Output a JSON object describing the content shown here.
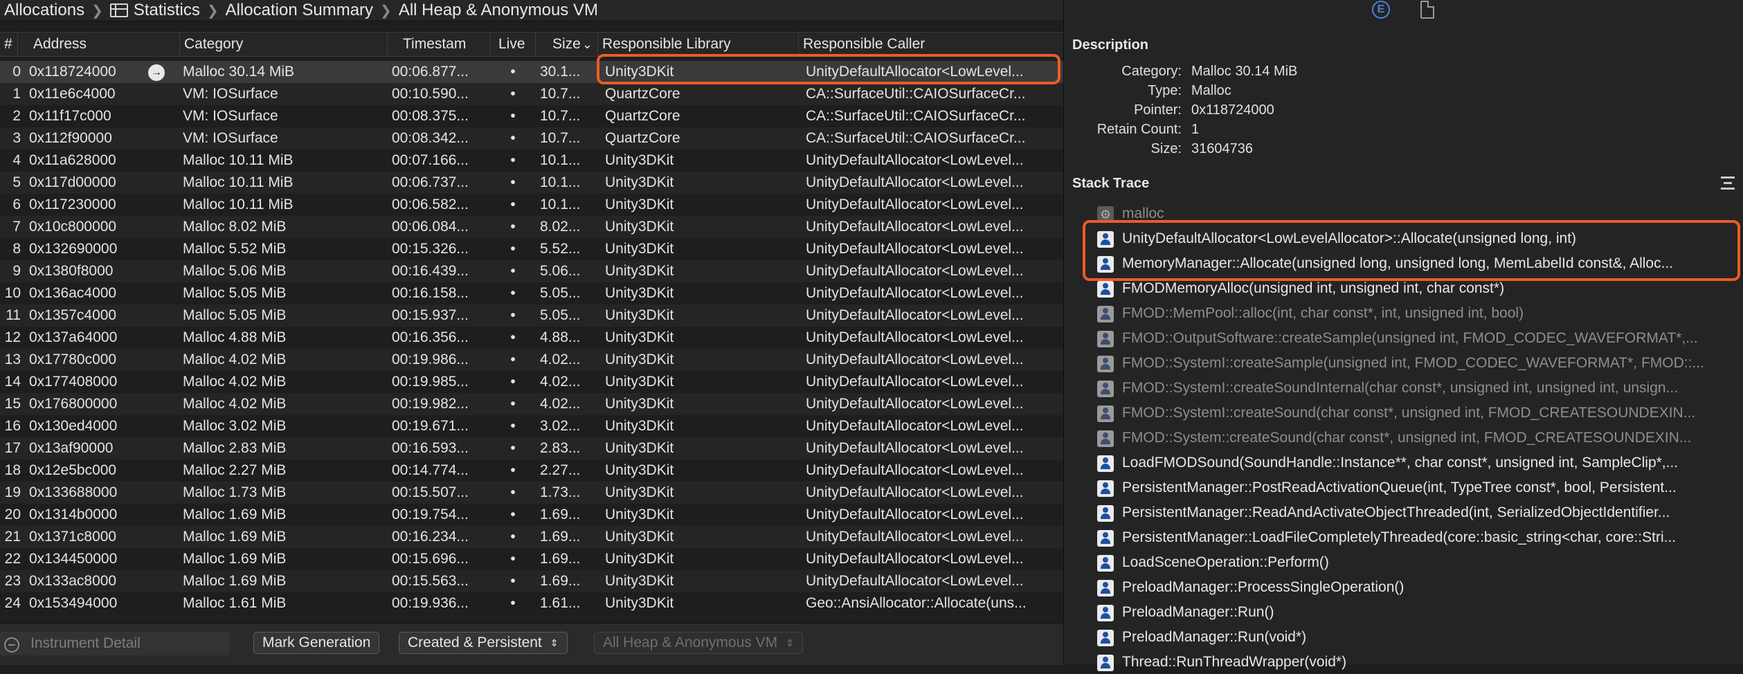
{
  "breadcrumb": {
    "items": [
      "Allocations",
      "Statistics",
      "Allocation Summary",
      "All Heap & Anonymous VM"
    ]
  },
  "table": {
    "headers": {
      "num": "#",
      "address": "Address",
      "category": "Category",
      "timestamp": "Timestam",
      "live": "Live",
      "size": "Size",
      "sort_indicator": "⌄",
      "library": "Responsible Library",
      "caller": "Responsible Caller"
    },
    "rows": [
      {
        "num": "0",
        "address": "0x118724000",
        "category": "Malloc 30.14 MiB",
        "timestamp": "00:06.877...",
        "live": "•",
        "size": "30.1...",
        "library": "Unity3DKit",
        "caller": "UnityDefaultAllocator<LowLevel..."
      },
      {
        "num": "1",
        "address": "0x11e6c4000",
        "category": "VM: IOSurface",
        "timestamp": "00:10.590...",
        "live": "•",
        "size": "10.7...",
        "library": "QuartzCore",
        "caller": "CA::SurfaceUtil::CAIOSurfaceCr..."
      },
      {
        "num": "2",
        "address": "0x11f17c000",
        "category": "VM: IOSurface",
        "timestamp": "00:08.375...",
        "live": "•",
        "size": "10.7...",
        "library": "QuartzCore",
        "caller": "CA::SurfaceUtil::CAIOSurfaceCr..."
      },
      {
        "num": "3",
        "address": "0x112f90000",
        "category": "VM: IOSurface",
        "timestamp": "00:08.342...",
        "live": "•",
        "size": "10.7...",
        "library": "QuartzCore",
        "caller": "CA::SurfaceUtil::CAIOSurfaceCr..."
      },
      {
        "num": "4",
        "address": "0x11a628000",
        "category": "Malloc 10.11 MiB",
        "timestamp": "00:07.166...",
        "live": "•",
        "size": "10.1...",
        "library": "Unity3DKit",
        "caller": "UnityDefaultAllocator<LowLevel..."
      },
      {
        "num": "5",
        "address": "0x117d00000",
        "category": "Malloc 10.11 MiB",
        "timestamp": "00:06.737...",
        "live": "•",
        "size": "10.1...",
        "library": "Unity3DKit",
        "caller": "UnityDefaultAllocator<LowLevel..."
      },
      {
        "num": "6",
        "address": "0x117230000",
        "category": "Malloc 10.11 MiB",
        "timestamp": "00:06.582...",
        "live": "•",
        "size": "10.1...",
        "library": "Unity3DKit",
        "caller": "UnityDefaultAllocator<LowLevel..."
      },
      {
        "num": "7",
        "address": "0x10c800000",
        "category": "Malloc 8.02 MiB",
        "timestamp": "00:06.084...",
        "live": "•",
        "size": "8.02...",
        "library": "Unity3DKit",
        "caller": "UnityDefaultAllocator<LowLevel..."
      },
      {
        "num": "8",
        "address": "0x132690000",
        "category": "Malloc 5.52 MiB",
        "timestamp": "00:15.326...",
        "live": "•",
        "size": "5.52...",
        "library": "Unity3DKit",
        "caller": "UnityDefaultAllocator<LowLevel..."
      },
      {
        "num": "9",
        "address": "0x1380f8000",
        "category": "Malloc 5.06 MiB",
        "timestamp": "00:16.439...",
        "live": "•",
        "size": "5.06...",
        "library": "Unity3DKit",
        "caller": "UnityDefaultAllocator<LowLevel..."
      },
      {
        "num": "10",
        "address": "0x136ac4000",
        "category": "Malloc 5.05 MiB",
        "timestamp": "00:16.158...",
        "live": "•",
        "size": "5.05...",
        "library": "Unity3DKit",
        "caller": "UnityDefaultAllocator<LowLevel..."
      },
      {
        "num": "11",
        "address": "0x1357c4000",
        "category": "Malloc 5.05 MiB",
        "timestamp": "00:15.937...",
        "live": "•",
        "size": "5.05...",
        "library": "Unity3DKit",
        "caller": "UnityDefaultAllocator<LowLevel..."
      },
      {
        "num": "12",
        "address": "0x137a64000",
        "category": "Malloc 4.88 MiB",
        "timestamp": "00:16.356...",
        "live": "•",
        "size": "4.88...",
        "library": "Unity3DKit",
        "caller": "UnityDefaultAllocator<LowLevel..."
      },
      {
        "num": "13",
        "address": "0x17780c000",
        "category": "Malloc 4.02 MiB",
        "timestamp": "00:19.986...",
        "live": "•",
        "size": "4.02...",
        "library": "Unity3DKit",
        "caller": "UnityDefaultAllocator<LowLevel..."
      },
      {
        "num": "14",
        "address": "0x177408000",
        "category": "Malloc 4.02 MiB",
        "timestamp": "00:19.985...",
        "live": "•",
        "size": "4.02...",
        "library": "Unity3DKit",
        "caller": "UnityDefaultAllocator<LowLevel..."
      },
      {
        "num": "15",
        "address": "0x176800000",
        "category": "Malloc 4.02 MiB",
        "timestamp": "00:19.982...",
        "live": "•",
        "size": "4.02...",
        "library": "Unity3DKit",
        "caller": "UnityDefaultAllocator<LowLevel..."
      },
      {
        "num": "16",
        "address": "0x130ed4000",
        "category": "Malloc 3.02 MiB",
        "timestamp": "00:19.671...",
        "live": "•",
        "size": "3.02...",
        "library": "Unity3DKit",
        "caller": "UnityDefaultAllocator<LowLevel..."
      },
      {
        "num": "17",
        "address": "0x13af90000",
        "category": "Malloc 2.83 MiB",
        "timestamp": "00:16.593...",
        "live": "•",
        "size": "2.83...",
        "library": "Unity3DKit",
        "caller": "UnityDefaultAllocator<LowLevel..."
      },
      {
        "num": "18",
        "address": "0x12e5bc000",
        "category": "Malloc 2.27 MiB",
        "timestamp": "00:14.774...",
        "live": "•",
        "size": "2.27...",
        "library": "Unity3DKit",
        "caller": "UnityDefaultAllocator<LowLevel..."
      },
      {
        "num": "19",
        "address": "0x133688000",
        "category": "Malloc 1.73 MiB",
        "timestamp": "00:15.507...",
        "live": "•",
        "size": "1.73...",
        "library": "Unity3DKit",
        "caller": "UnityDefaultAllocator<LowLevel..."
      },
      {
        "num": "20",
        "address": "0x1314b0000",
        "category": "Malloc 1.69 MiB",
        "timestamp": "00:19.754...",
        "live": "•",
        "size": "1.69...",
        "library": "Unity3DKit",
        "caller": "UnityDefaultAllocator<LowLevel..."
      },
      {
        "num": "21",
        "address": "0x1371c8000",
        "category": "Malloc 1.69 MiB",
        "timestamp": "00:16.234...",
        "live": "•",
        "size": "1.69...",
        "library": "Unity3DKit",
        "caller": "UnityDefaultAllocator<LowLevel..."
      },
      {
        "num": "22",
        "address": "0x134450000",
        "category": "Malloc 1.69 MiB",
        "timestamp": "00:15.696...",
        "live": "•",
        "size": "1.69...",
        "library": "Unity3DKit",
        "caller": "UnityDefaultAllocator<LowLevel..."
      },
      {
        "num": "23",
        "address": "0x133ac8000",
        "category": "Malloc 1.69 MiB",
        "timestamp": "00:15.563...",
        "live": "•",
        "size": "1.69...",
        "library": "Unity3DKit",
        "caller": "UnityDefaultAllocator<LowLevel..."
      },
      {
        "num": "24",
        "address": "0x153494000",
        "category": "Malloc 1.61 MiB",
        "timestamp": "00:19.936...",
        "live": "•",
        "size": "1.61...",
        "library": "Unity3DKit",
        "caller": "Geo::AnsiAllocator::Allocate(uns..."
      }
    ]
  },
  "bottom_bar": {
    "filter_placeholder": "Instrument Detail",
    "mark_generation": "Mark Generation",
    "lifespan_select": "Created & Persistent",
    "allocation_type_select": "All Heap & Anonymous VM",
    "stepper_glyph": "⇕"
  },
  "inspector": {
    "extended_detail_icon": "E",
    "description": {
      "title": "Description",
      "fields": [
        {
          "label": "Category:",
          "value": "Malloc 30.14 MiB"
        },
        {
          "label": "Type:",
          "value": "Malloc"
        },
        {
          "label": "Pointer:",
          "value": "0x118724000"
        },
        {
          "label": "Retain Count:",
          "value": "1"
        },
        {
          "label": "Size:",
          "value": "31604736"
        }
      ]
    },
    "stack_trace": {
      "title": "Stack Trace",
      "frames": [
        {
          "icon": "gear",
          "text": "malloc"
        },
        {
          "icon": "user",
          "text": "UnityDefaultAllocator<LowLevelAllocator>::Allocate(unsigned long, int)"
        },
        {
          "icon": "user",
          "text": "MemoryManager::Allocate(unsigned long, unsigned long, MemLabelId const&, Alloc..."
        },
        {
          "icon": "user",
          "text": "FMODMemoryAlloc(unsigned int, unsigned int, char const*)"
        },
        {
          "icon": "userdim",
          "text": "FMOD::MemPool::alloc(int, char const*, int, unsigned int, bool)"
        },
        {
          "icon": "userdim",
          "text": "FMOD::OutputSoftware::createSample(unsigned int, FMOD_CODEC_WAVEFORMAT*,..."
        },
        {
          "icon": "userdim",
          "text": "FMOD::SystemI::createSample(unsigned int, FMOD_CODEC_WAVEFORMAT*, FMOD::..."
        },
        {
          "icon": "userdim",
          "text": "FMOD::SystemI::createSoundInternal(char const*, unsigned int, unsigned int, unsign..."
        },
        {
          "icon": "userdim",
          "text": "FMOD::SystemI::createSound(char const*, unsigned int, FMOD_CREATESOUNDEXIN..."
        },
        {
          "icon": "userdim",
          "text": "FMOD::System::createSound(char const*, unsigned int, FMOD_CREATESOUNDEXIN..."
        },
        {
          "icon": "user",
          "text": "LoadFMODSound(SoundHandle::Instance**, char const*, unsigned int, SampleClip*,..."
        },
        {
          "icon": "user",
          "text": "PersistentManager::PostReadActivationQueue(int, TypeTree const*, bool, Persistent..."
        },
        {
          "icon": "user",
          "text": "PersistentManager::ReadAndActivateObjectThreaded(int, SerializedObjectIdentifier..."
        },
        {
          "icon": "user",
          "text": "PersistentManager::LoadFileCompletelyThreaded(core::basic_string<char, core::Stri..."
        },
        {
          "icon": "user",
          "text": "LoadSceneOperation::Perform()"
        },
        {
          "icon": "user",
          "text": "PreloadManager::ProcessSingleOperation()"
        },
        {
          "icon": "user",
          "text": "PreloadManager::Run()"
        },
        {
          "icon": "user",
          "text": "PreloadManager::Run(void*)"
        },
        {
          "icon": "user",
          "text": "Thread::RunThreadWrapper(void*)"
        }
      ]
    }
  },
  "colors": {
    "highlight": "#ec5a28",
    "accent_blue": "#4a7fe0",
    "background": "#1e1e1e"
  }
}
